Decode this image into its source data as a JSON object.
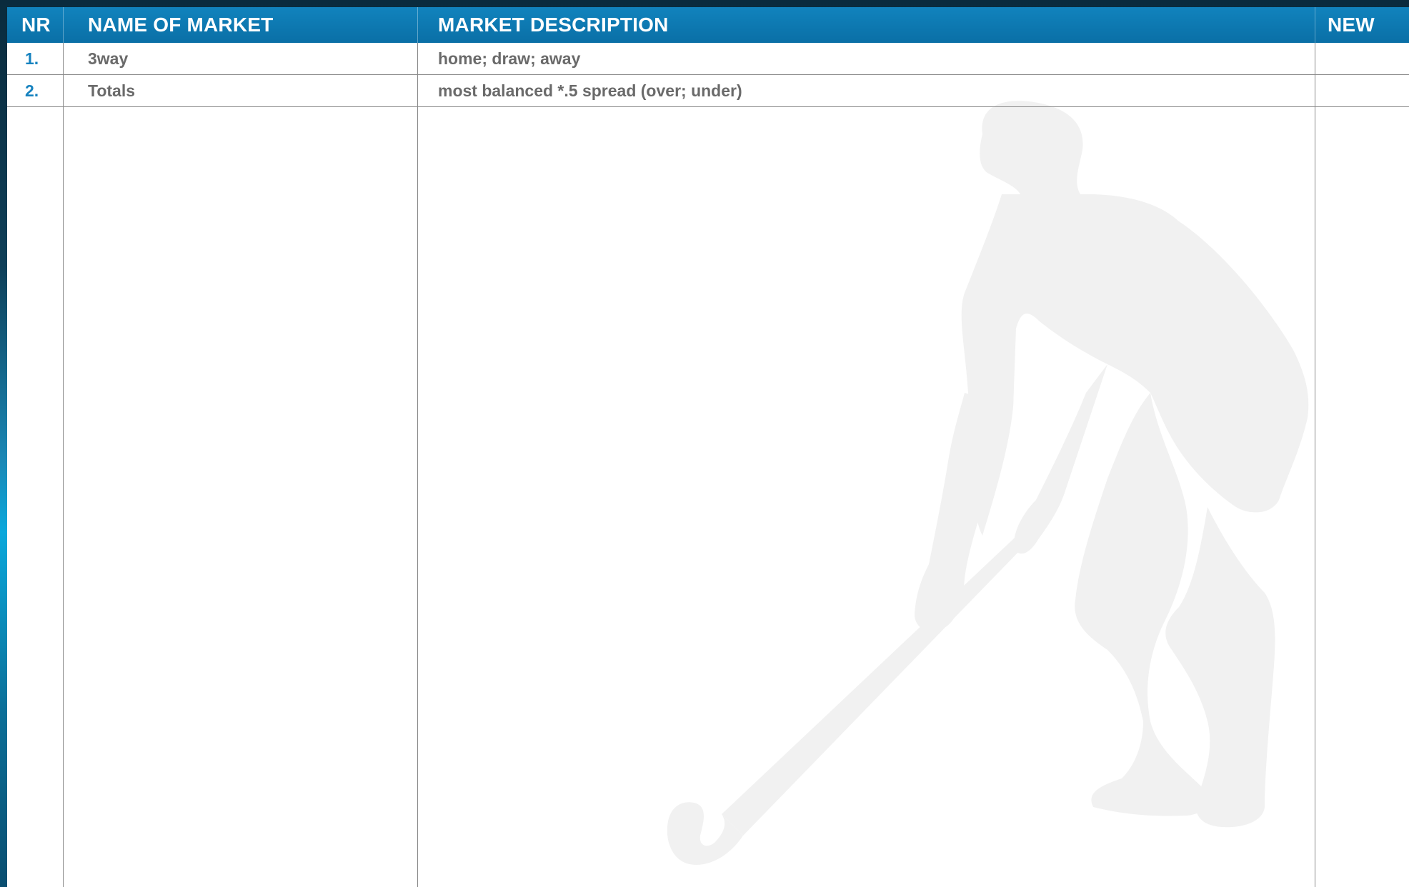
{
  "table": {
    "headers": {
      "nr": "NR",
      "name": "NAME OF MARKET",
      "description": "MARKET DESCRIPTION",
      "new": "NEW"
    },
    "rows": [
      {
        "nr": "1.",
        "name": "3way",
        "description": "home; draw; away",
        "new": ""
      },
      {
        "nr": "2.",
        "name": "Totals",
        "description": "most balanced *.5 spread (over; under)",
        "new": ""
      }
    ]
  },
  "colors": {
    "header_blue": "#0a6fa6",
    "number_blue": "#1682bf",
    "text_gray": "#6a6a6a",
    "silhouette_gray": "#f1f1f1"
  },
  "background_image": "field-hockey-player-silhouette"
}
